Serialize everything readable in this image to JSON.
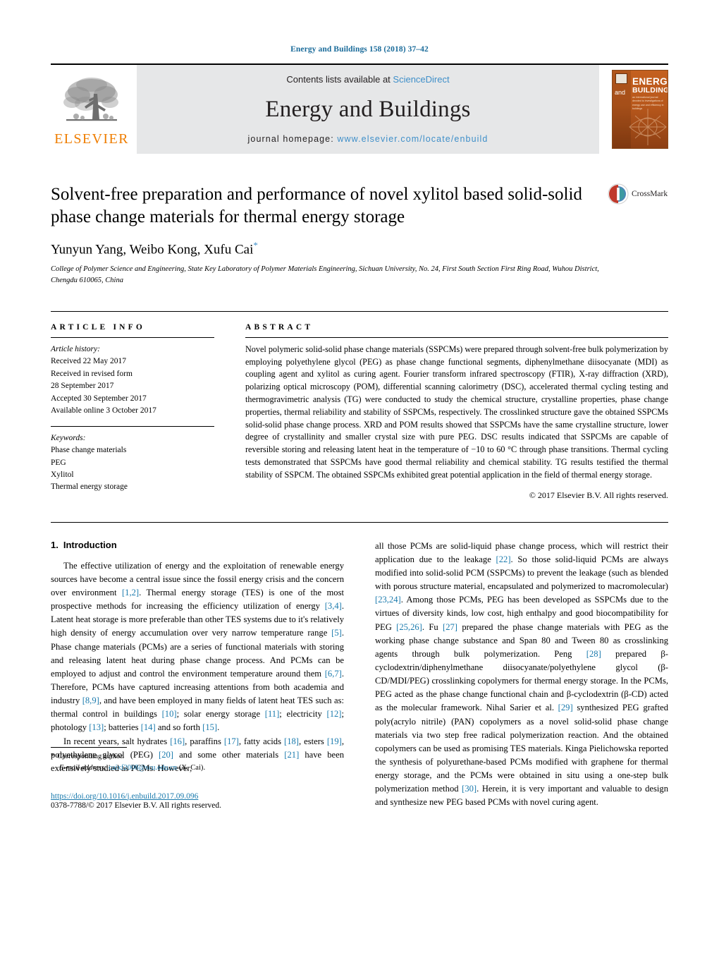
{
  "running_head": "Energy and Buildings 158 (2018) 37–42",
  "masthead": {
    "publisher_logo_word": "ELSEVIER",
    "contents_prefix": "Contents lists available at ",
    "contents_link": "ScienceDirect",
    "journal_title": "Energy and Buildings",
    "homepage_prefix": "journal homepage: ",
    "homepage_url": "www.elsevier.com/locate/enbuild",
    "cover": {
      "line_and": "and",
      "line_energy": "ENERGY",
      "line_buildings": "BUILDINGS",
      "sub": "an international journal devoted to investigations of energy use and efficiency in buildings"
    }
  },
  "article": {
    "title": "Solvent-free preparation and performance of novel xylitol based solid-solid phase change materials for thermal energy storage",
    "authors": "Yunyun Yang, Weibo Kong, Xufu Cai",
    "author_star": "*",
    "affiliation": "College of Polymer Science and Engineering, State Key Laboratory of Polymer Materials Engineering, Sichuan University, No. 24, First South Section First Ring Road, Wuhou District, Chengdu 610065, China",
    "crossmark_label": "CrossMark"
  },
  "article_info": {
    "heading": "ARTICLE INFO",
    "history_label": "Article history:",
    "history": [
      "Received 22 May 2017",
      "Received in revised form",
      "28 September 2017",
      "Accepted 30 September 2017",
      "Available online 3 October 2017"
    ],
    "keywords_label": "Keywords:",
    "keywords": [
      "Phase change materials",
      "PEG",
      "Xylitol",
      "Thermal energy storage"
    ]
  },
  "abstract": {
    "heading": "ABSTRACT",
    "text": "Novel polymeric solid-solid phase change materials (SSPCMs) were prepared through solvent-free bulk polymerization by employing polyethylene glycol (PEG) as phase change functional segments, diphenylmethane diisocyanate (MDI) as coupling agent and xylitol as curing agent. Fourier transform infrared spectroscopy (FTIR), X-ray diffraction (XRD), polarizing optical microscopy (POM), differential scanning calorimetry (DSC), accelerated thermal cycling testing and thermogravimetric analysis (TG) were conducted to study the chemical structure, crystalline properties, phase change properties, thermal reliability and stability of SSPCMs, respectively. The crosslinked structure gave the obtained SSPCMs solid-solid phase change process. XRD and POM results showed that SSPCMs have the same crystalline structure, lower degree of crystallinity and smaller crystal size with pure PEG. DSC results indicated that SSPCMs are capable of reversible storing and releasing latent heat in the temperature of −10 to 60 °C through phase transitions. Thermal cycling tests demonstrated that SSPCMs have good thermal reliability and chemical stability. TG results testified the thermal stability of SSPCM. The obtained SSPCMs exhibited great potential application in the field of thermal energy storage.",
    "copyright": "© 2017 Elsevier B.V. All rights reserved."
  },
  "introduction": {
    "number": "1.",
    "heading": "Introduction",
    "paragraph_1_a": "The effective utilization of energy and the exploitation of renewable energy sources have become a central issue since the fossil energy crisis and the concern over environment ",
    "ref_1_2": "[1,2]",
    "paragraph_1_b": ". Thermal energy storage (TES) is one of the most prospective methods for increasing the efficiency utilization of energy ",
    "ref_3_4": "[3,4]",
    "paragraph_1_c": ". Latent heat storage is more preferable than other TES systems due to it's relatively high density of energy accumulation over very narrow temperature range ",
    "ref_5": "[5]",
    "paragraph_1_d": ". Phase change materials (PCMs) are a series of functional materials with storing and releasing latent heat during phase change process. And PCMs can be employed to adjust and control the environment temperature around them ",
    "ref_6_7": "[6,7]",
    "paragraph_1_e": ". Therefore, PCMs have captured increasing attentions from both academia and industry ",
    "ref_8_9": "[8,9]",
    "paragraph_1_f": ", and have been employed in many fields of latent heat TES such as: thermal control in buildings ",
    "ref_10": "[10]",
    "paragraph_1_g": "; solar energy storage ",
    "ref_11": "[11]",
    "paragraph_1_h": "; electricity ",
    "ref_12": "[12]",
    "paragraph_1_i": "; photology ",
    "ref_13": "[13]",
    "paragraph_1_j": "; batteries ",
    "ref_14": "[14]",
    "paragraph_1_k": " and so forth ",
    "ref_15": "[15]",
    "paragraph_1_l": ".",
    "paragraph_2_a": "In recent years, salt hydrates ",
    "ref_16": "[16]",
    "paragraph_2_b": ", paraffins ",
    "ref_17": "[17]",
    "paragraph_2_c": ", fatty acids ",
    "ref_18": "[18]",
    "paragraph_2_d": ", esters ",
    "ref_19": "[19]",
    "paragraph_2_e": ", polyethylene glycol (PEG) ",
    "ref_20": "[20]",
    "paragraph_2_f": " and some other materials ",
    "ref_21": "[21]",
    "paragraph_2_g": " have been extensively studied as PCMs. However, ",
    "paragraph_2_h": "all those PCMs are solid-liquid phase change process, which will restrict their application due to the leakage ",
    "ref_22": "[22]",
    "paragraph_2_i": ". So those solid-liquid PCMs are always modified into solid-solid PCM (SSPCMs) to prevent the leakage (such as blended with porous structure material, encapsulated and polymerized to macromolecular) ",
    "ref_23_24": "[23,24]",
    "paragraph_2_j": ". Among those PCMs, PEG has been developed as SSPCMs due to the virtues of diversity kinds, low cost, high enthalpy and good biocompatibility for PEG ",
    "ref_25_26": "[25,26]",
    "paragraph_2_k": ". Fu ",
    "ref_27": "[27]",
    "paragraph_2_l": " prepared the phase change materials with PEG as the working phase change substance and Span 80 and Tween 80 as crosslinking agents through bulk polymerization. Peng ",
    "ref_28": "[28]",
    "paragraph_2_m": " prepared β-cyclodextrin/diphenylmethane diisocyanate/polyethylene glycol (β-CD/MDI/PEG) crosslinking copolymers for thermal energy storage. In the PCMs, PEG acted as the phase change functional chain and β-cyclodextrin (β-CD) acted as the molecular framework. Nihal Sarier et al. ",
    "ref_29": "[29]",
    "paragraph_2_n": " synthesized PEG grafted poly(acrylo nitrile) (PAN) copolymers as a novel solid-solid phase change materials via two step free radical polymerization reaction. And the obtained copolymers can be used as promising TES materials. Kinga Pielichowska reported the synthesis of polyurethane-based PCMs modified with graphene for thermal energy storage, and the PCMs were obtained in situ using a one-step bulk polymerization method ",
    "ref_30": "[30]",
    "paragraph_2_o": ". Herein, it is very important and valuable to design and synthesize new PEG based PCMs with novel curing agent."
  },
  "footer": {
    "corresponding_star": "*",
    "corresponding_label": "Corresponding author.",
    "email_label": "E-mail address:",
    "email": "caixf2008@scu.edu.cn",
    "email_suffix": "(X. Cai).",
    "doi": "https://doi.org/10.1016/j.enbuild.2017.09.096",
    "issn_line": "0378-7788/© 2017 Elsevier B.V. All rights reserved."
  },
  "colors": {
    "link_blue": "#1a7aad",
    "sciencedirect_blue": "#3f8fc9",
    "elsevier_orange": "#ef7d00",
    "masthead_gray": "#e6e7e8"
  }
}
